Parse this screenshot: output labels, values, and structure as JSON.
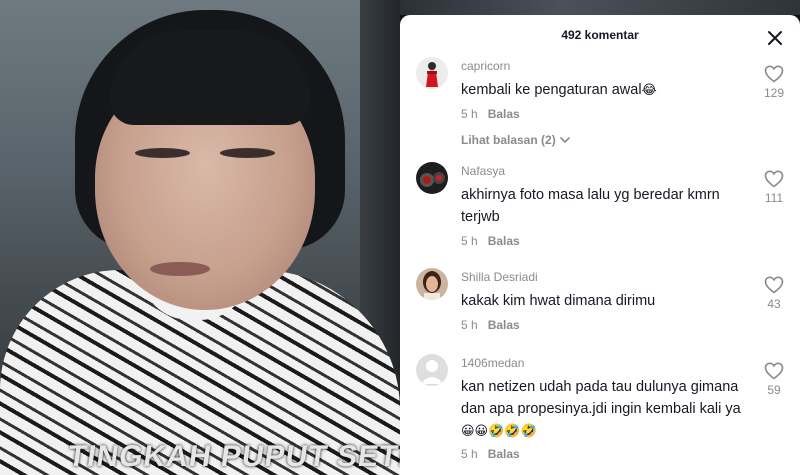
{
  "video": {
    "caption": "TINGKAH PUPUT SETELAH"
  },
  "comments_panel": {
    "title": "492 komentar",
    "close_icon": "close-icon",
    "reply_label": "Balas",
    "comments": [
      {
        "username": "capricorn",
        "text": "kembali ke pengaturan awal",
        "emoji": "😂",
        "time": "5 h",
        "likes": "129",
        "view_replies": "Lihat balasan (2)"
      },
      {
        "username": "Nafasya",
        "text": "akhirnya foto masa lalu yg beredar kmrn terjwb",
        "emoji": "",
        "time": "5 h",
        "likes": "111"
      },
      {
        "username": "Shilla Desriadi",
        "text": "kakak kim hwat dimana dirimu",
        "emoji": "",
        "time": "5 h",
        "likes": "43"
      },
      {
        "username": "1406medan",
        "text": "kan netizen udah pada tau dulunya gimana dan apa propesinya.jdi ingin kembali kali ya",
        "emoji": "😀😀🤣🤣🤣",
        "time": "5 h",
        "likes": "59"
      }
    ]
  },
  "colors": {
    "panel_bg": "#ffffff",
    "text_primary": "#161823",
    "text_secondary": "#8a8b91"
  }
}
